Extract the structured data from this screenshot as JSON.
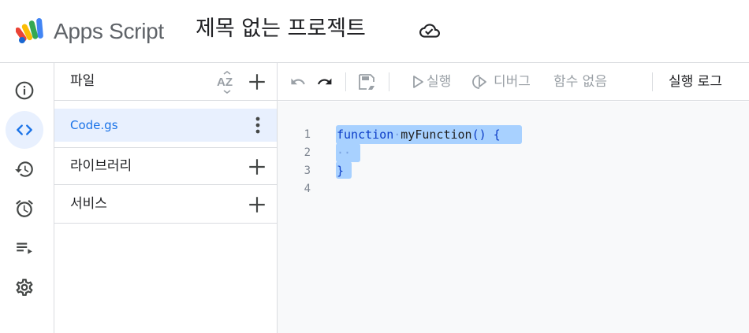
{
  "header": {
    "app_name": "Apps Script",
    "project_title": "제목 없는 프로젝트",
    "save_status_icon": "cloud-done-icon"
  },
  "rail": {
    "items": [
      {
        "name": "overview",
        "icon": "info-icon"
      },
      {
        "name": "editor",
        "icon": "code-icon",
        "active": true
      },
      {
        "name": "executions",
        "icon": "history-icon"
      },
      {
        "name": "triggers",
        "icon": "alarm-icon"
      },
      {
        "name": "logs",
        "icon": "playlist-play-icon"
      },
      {
        "name": "settings",
        "icon": "gear-icon"
      }
    ]
  },
  "files_panel": {
    "files_label": "파일",
    "sort_icon": "sort-az-icon",
    "files": [
      {
        "name": "Code.gs"
      }
    ],
    "libraries_label": "라이브러리",
    "services_label": "서비스"
  },
  "toolbar": {
    "run_label": "실행",
    "debug_label": "디버그",
    "function_select": "함수 없음",
    "execution_log_label": "실행 로그"
  },
  "editor": {
    "line_numbers": [
      "1",
      "2",
      "3",
      "4"
    ],
    "code": {
      "line1_keyword": "function",
      "line1_name": "myFunction",
      "line1_rest": "() {",
      "line2": "··",
      "line3": "}",
      "line4": ""
    }
  },
  "colors": {
    "accent": "#1a73e8",
    "active_bg": "#e8f0fe",
    "selection": "#a8d1ff",
    "border": "#dadce0",
    "editor_bg": "#f8f9fa"
  }
}
